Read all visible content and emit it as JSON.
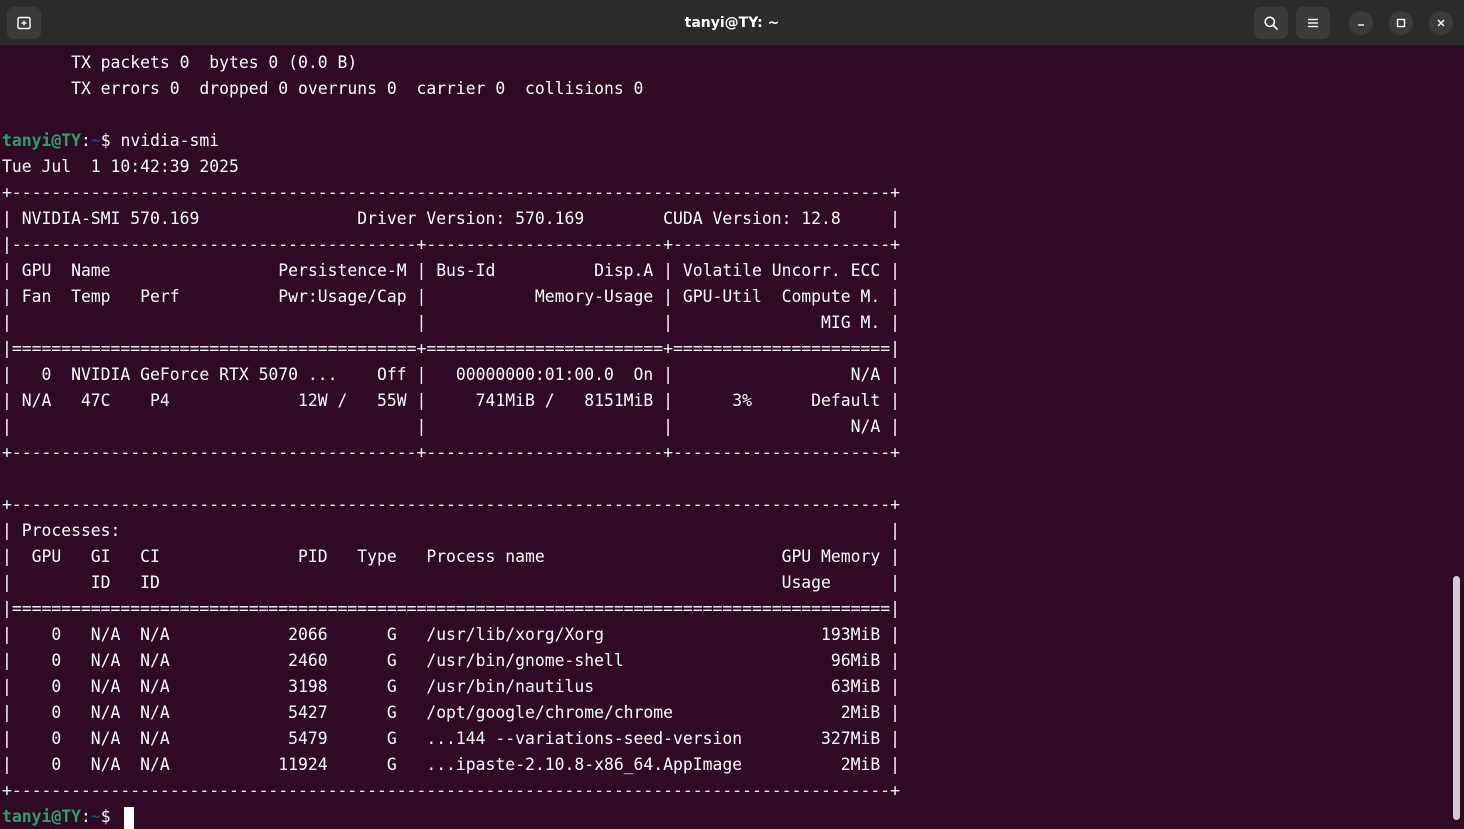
{
  "window": {
    "title": "tanyi@TY: ~"
  },
  "prompt": {
    "user": "tanyi@TY",
    "sep": ":",
    "path": "~",
    "symbol": "$ "
  },
  "lines_before": [
    "       TX packets 0  bytes 0 (0.0 B)",
    "       TX errors 0  dropped 0 overruns 0  carrier 0  collisions 0",
    ""
  ],
  "command": "nvidia-smi",
  "output_lines": [
    "Tue Jul  1 10:42:39 2025       ",
    "+-----------------------------------------------------------------------------------------+",
    "| NVIDIA-SMI 570.169                Driver Version: 570.169        CUDA Version: 12.8     |",
    "|-----------------------------------------+------------------------+----------------------+",
    "| GPU  Name                 Persistence-M | Bus-Id          Disp.A | Volatile Uncorr. ECC |",
    "| Fan  Temp   Perf          Pwr:Usage/Cap |           Memory-Usage | GPU-Util  Compute M. |",
    "|                                         |                        |               MIG M. |",
    "|=========================================+========================+======================|",
    "|   0  NVIDIA GeForce RTX 5070 ...    Off |   00000000:01:00.0  On |                  N/A |",
    "| N/A   47C    P4             12W /   55W |     741MiB /   8151MiB |      3%      Default |",
    "|                                         |                        |                  N/A |",
    "+-----------------------------------------+------------------------+----------------------+",
    "",
    "+-----------------------------------------------------------------------------------------+",
    "| Processes:                                                                              |",
    "|  GPU   GI   CI              PID   Type   Process name                        GPU Memory |",
    "|        ID   ID                                                               Usage      |",
    "|=========================================================================================|",
    "|    0   N/A  N/A            2066      G   /usr/lib/xorg/Xorg                      193MiB |",
    "|    0   N/A  N/A            2460      G   /usr/bin/gnome-shell                     96MiB |",
    "|    0   N/A  N/A            3198      G   /usr/bin/nautilus                        63MiB |",
    "|    0   N/A  N/A            5427      G   /opt/google/chrome/chrome                 2MiB |",
    "|    0   N/A  N/A            5479      G   ...144 --variations-seed-version        327MiB |",
    "|    0   N/A  N/A           11924      G   ...ipaste-2.10.8-x86_64.AppImage          2MiB |",
    "+-----------------------------------------------------------------------------------------+"
  ],
  "icons": {
    "new_tab": "new-tab-icon",
    "search": "search-icon",
    "menu": "hamburger-menu-icon",
    "minimize": "minimize-icon",
    "maximize": "maximize-icon",
    "close": "close-icon"
  },
  "colors": {
    "background": "#300a24",
    "titlebar": "#2b2b2b",
    "prompt_user": "#26a269",
    "prompt_path": "#12488b",
    "text": "#ffffff"
  }
}
